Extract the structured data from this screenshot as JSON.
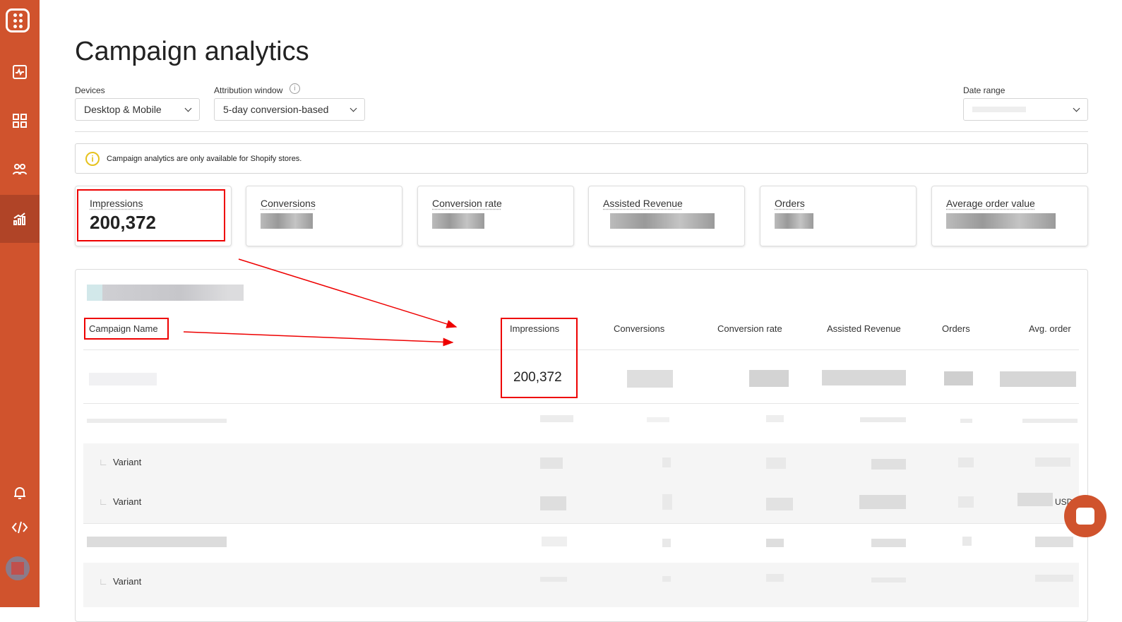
{
  "sidebar": {
    "items": [
      "activity-icon",
      "dashboard-icon",
      "users-icon",
      "analytics-icon",
      "bell-icon",
      "code-icon"
    ],
    "active": "analytics",
    "accent": "#d0532d"
  },
  "page": {
    "title": "Campaign analytics"
  },
  "filters": {
    "devices_label": "Devices",
    "devices_value": "Desktop & Mobile",
    "attribution_label": "Attribution window",
    "attribution_value": "5-day conversion-based",
    "date_label": "Date range",
    "date_value": ""
  },
  "notice": {
    "text": "Campaign analytics are only available for Shopify stores."
  },
  "cards": [
    {
      "title": "Impressions",
      "value": "200,372"
    },
    {
      "title": "Conversions",
      "value": ""
    },
    {
      "title": "Conversion rate",
      "value": ""
    },
    {
      "title": "Assisted Revenue",
      "value": ""
    },
    {
      "title": "Orders",
      "value": ""
    },
    {
      "title": "Average order value",
      "value": ""
    }
  ],
  "table": {
    "columns": [
      "Campaign Name",
      "Impressions",
      "Conversions",
      "Conversion rate",
      "Assisted Revenue",
      "Orders",
      "Avg. order"
    ],
    "first_row_impressions": "200,372",
    "variant_label": "Variant",
    "currency": "USD"
  }
}
